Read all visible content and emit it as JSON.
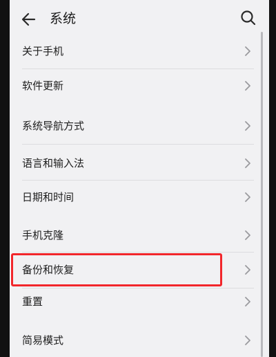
{
  "header": {
    "title": "系统",
    "back_icon": "arrow-left-icon",
    "search_icon": "search-icon"
  },
  "menu": {
    "items": [
      {
        "label": "关于手机"
      },
      {
        "label": "软件更新"
      },
      {
        "label": "系统导航方式"
      },
      {
        "label": "语言和输入法"
      },
      {
        "label": "日期和时间"
      },
      {
        "label": "手机克隆"
      },
      {
        "label": "备份和恢复"
      },
      {
        "label": "重置"
      },
      {
        "label": "简易模式"
      }
    ],
    "chevron_icon": "chevron-right-icon"
  },
  "colors": {
    "background": "#f1f1f3",
    "text": "#1e1e1e",
    "highlight": "#f2262b"
  }
}
